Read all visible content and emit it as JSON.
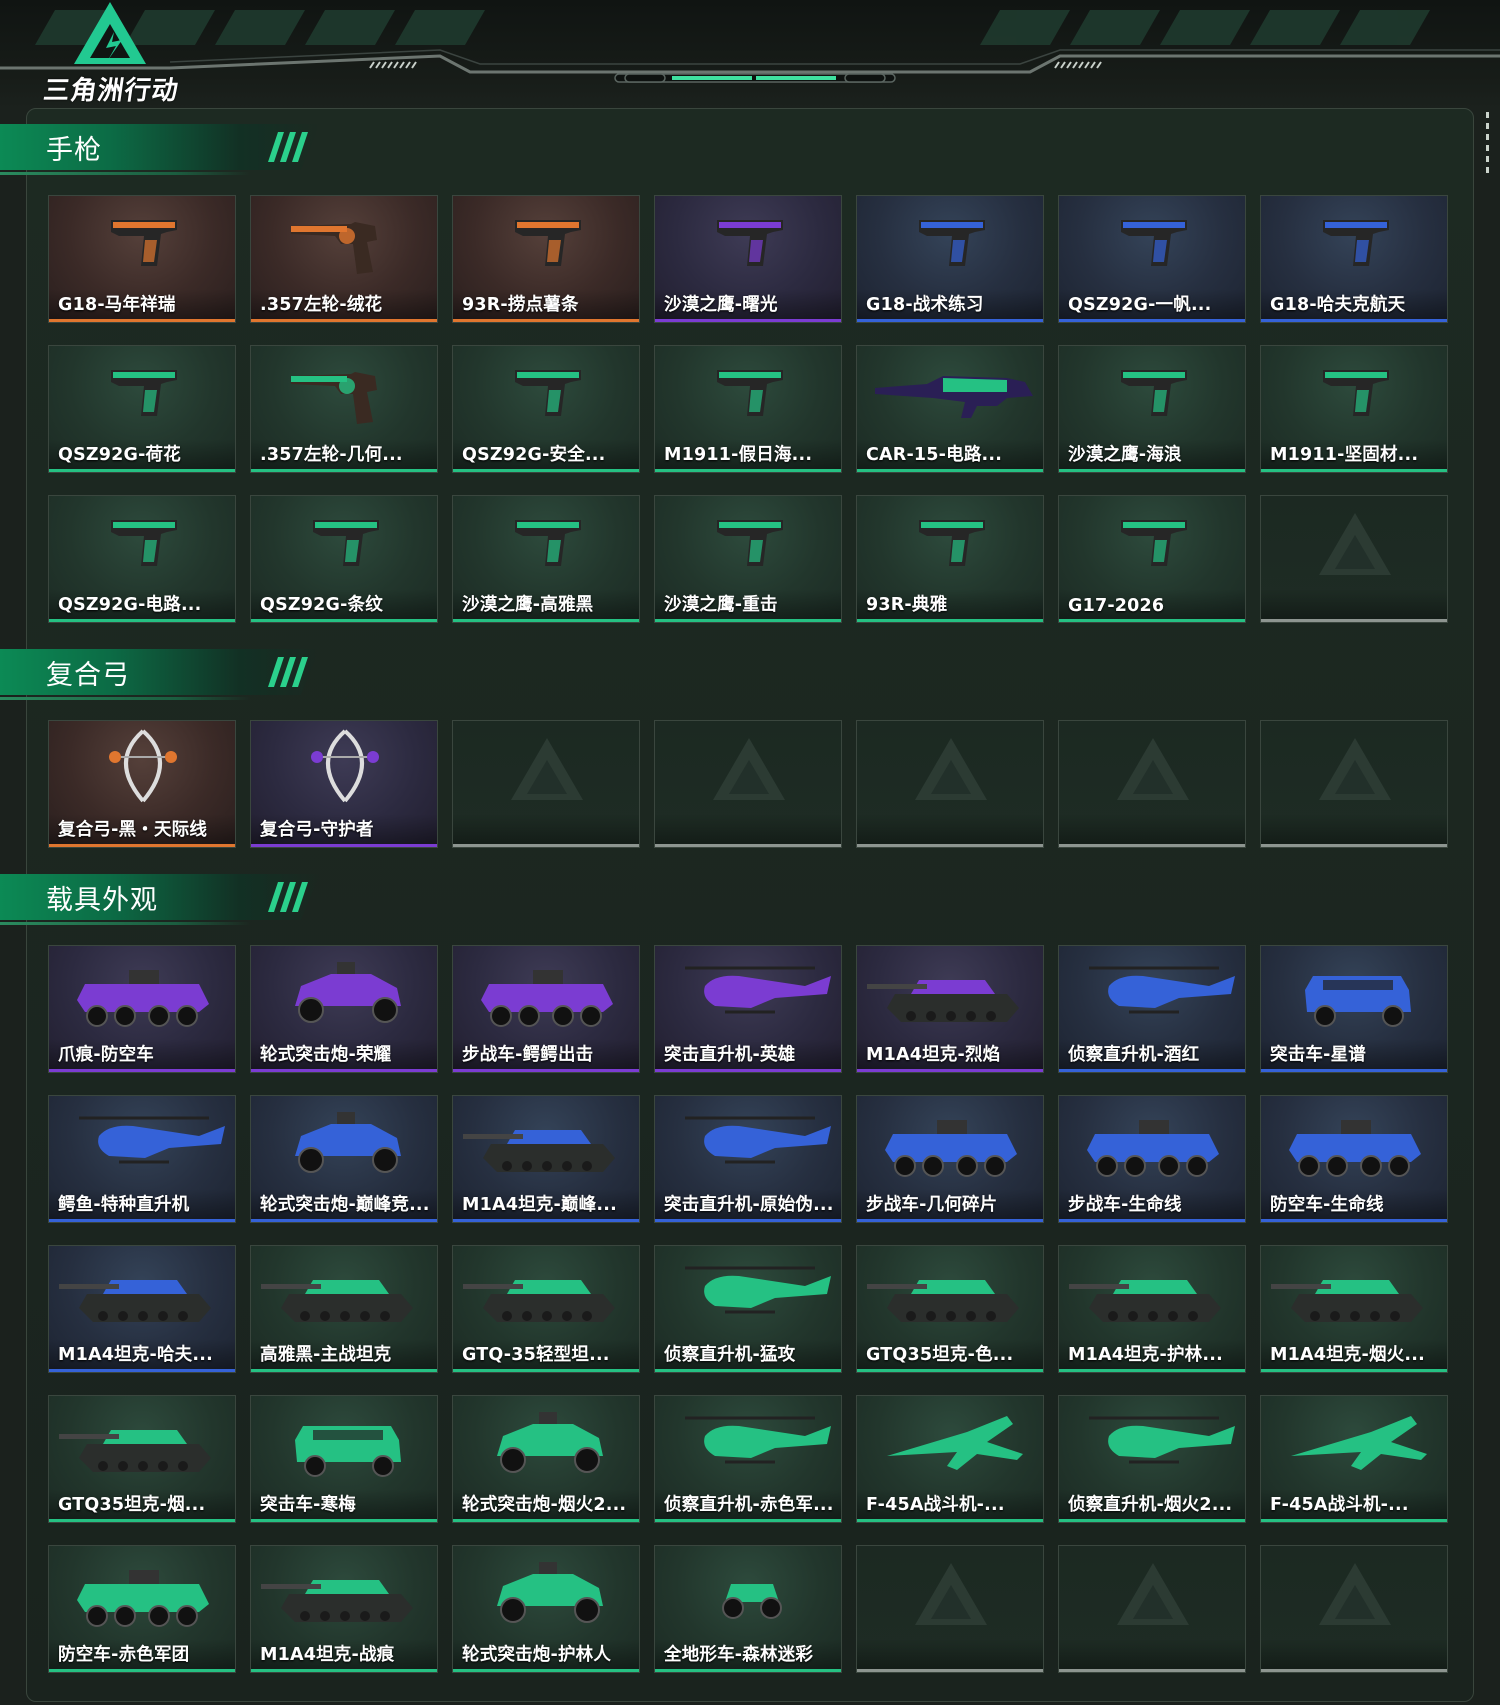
{
  "app": {
    "logo_text": "三角洲行动"
  },
  "colors": {
    "orange": "#e0762f",
    "purple": "#7b3cd2",
    "blue": "#3562d8",
    "green": "#25c183",
    "empty": "#8d9590",
    "brand": "#1cbf7d"
  },
  "sections": [
    {
      "id": "pistols",
      "title": "手枪",
      "items": [
        {
          "label": "G18-马年祥瑞",
          "rarity": "orange",
          "icon": "pistol-icon"
        },
        {
          "label": ".357左轮-绒花",
          "rarity": "orange",
          "icon": "revolver-icon"
        },
        {
          "label": "93R-捞点薯条",
          "rarity": "orange",
          "icon": "pistol-icon"
        },
        {
          "label": "沙漠之鹰-曙光",
          "rarity": "purple",
          "icon": "pistol-icon"
        },
        {
          "label": "G18-战术练习",
          "rarity": "blue",
          "icon": "pistol-icon"
        },
        {
          "label": "QSZ92G-一帆...",
          "rarity": "blue",
          "icon": "pistol-icon"
        },
        {
          "label": "G18-哈夫克航天",
          "rarity": "blue",
          "icon": "pistol-icon"
        },
        {
          "label": "QSZ92G-荷花",
          "rarity": "green",
          "icon": "pistol-icon"
        },
        {
          "label": ".357左轮-几何...",
          "rarity": "green",
          "icon": "revolver-icon"
        },
        {
          "label": "QSZ92G-安全...",
          "rarity": "green",
          "icon": "pistol-icon"
        },
        {
          "label": "M1911-假日海...",
          "rarity": "green",
          "icon": "pistol-icon"
        },
        {
          "label": "CAR-15-电路...",
          "rarity": "green",
          "icon": "rifle-icon"
        },
        {
          "label": "沙漠之鹰-海浪",
          "rarity": "green",
          "icon": "pistol-icon"
        },
        {
          "label": "M1911-坚固材...",
          "rarity": "green",
          "icon": "pistol-icon"
        },
        {
          "label": "QSZ92G-电路...",
          "rarity": "green",
          "icon": "pistol-icon"
        },
        {
          "label": "QSZ92G-条纹",
          "rarity": "green",
          "icon": "pistol-icon"
        },
        {
          "label": "沙漠之鹰-高雅黑",
          "rarity": "green",
          "icon": "pistol-icon"
        },
        {
          "label": "沙漠之鹰-重击",
          "rarity": "green",
          "icon": "pistol-icon"
        },
        {
          "label": "93R-典雅",
          "rarity": "green",
          "icon": "pistol-icon"
        },
        {
          "label": "G17-2026",
          "rarity": "green",
          "icon": "pistol-icon"
        },
        {
          "label": "",
          "rarity": "empty",
          "icon": ""
        }
      ]
    },
    {
      "id": "compound-bows",
      "title": "复合弓",
      "items": [
        {
          "label": "复合弓-黑・天际线",
          "rarity": "orange",
          "icon": "bow-icon"
        },
        {
          "label": "复合弓-守护者",
          "rarity": "purple",
          "icon": "bow-icon"
        },
        {
          "label": "",
          "rarity": "empty",
          "icon": ""
        },
        {
          "label": "",
          "rarity": "empty",
          "icon": ""
        },
        {
          "label": "",
          "rarity": "empty",
          "icon": ""
        },
        {
          "label": "",
          "rarity": "empty",
          "icon": ""
        },
        {
          "label": "",
          "rarity": "empty",
          "icon": ""
        }
      ]
    },
    {
      "id": "vehicle-skins",
      "title": "载具外观",
      "items": [
        {
          "label": "爪痕-防空车",
          "rarity": "purple",
          "icon": "apc-icon"
        },
        {
          "label": "轮式突击炮-荣耀",
          "rarity": "purple",
          "icon": "buggy-icon"
        },
        {
          "label": "步战车-鳄鳄出击",
          "rarity": "purple",
          "icon": "apc-icon"
        },
        {
          "label": "突击直升机-英雄",
          "rarity": "purple",
          "icon": "helicopter-icon"
        },
        {
          "label": "M1A4坦克-烈焰",
          "rarity": "purple",
          "icon": "tank-icon"
        },
        {
          "label": "侦察直升机-酒红",
          "rarity": "blue",
          "icon": "helicopter-icon"
        },
        {
          "label": "突击车-星谱",
          "rarity": "blue",
          "icon": "truck-icon"
        },
        {
          "label": "鳄鱼-特种直升机",
          "rarity": "blue",
          "icon": "helicopter-icon"
        },
        {
          "label": "轮式突击炮-巅峰竞...",
          "rarity": "blue",
          "icon": "buggy-icon"
        },
        {
          "label": "M1A4坦克-巅峰...",
          "rarity": "blue",
          "icon": "tank-icon"
        },
        {
          "label": "突击直升机-原始伪...",
          "rarity": "blue",
          "icon": "helicopter-icon"
        },
        {
          "label": "步战车-几何碎片",
          "rarity": "blue",
          "icon": "apc-icon"
        },
        {
          "label": "步战车-生命线",
          "rarity": "blue",
          "icon": "apc-icon"
        },
        {
          "label": "防空车-生命线",
          "rarity": "blue",
          "icon": "apc-icon"
        },
        {
          "label": "M1A4坦克-哈夫...",
          "rarity": "blue",
          "icon": "tank-icon"
        },
        {
          "label": "高雅黑-主战坦克",
          "rarity": "green",
          "icon": "tank-icon"
        },
        {
          "label": "GTQ-35轻型坦...",
          "rarity": "green",
          "icon": "tank-icon"
        },
        {
          "label": "侦察直升机-猛攻",
          "rarity": "green",
          "icon": "helicopter-icon"
        },
        {
          "label": "GTQ35坦克-色...",
          "rarity": "green",
          "icon": "tank-icon"
        },
        {
          "label": "M1A4坦克-护林...",
          "rarity": "green",
          "icon": "tank-icon"
        },
        {
          "label": "M1A4坦克-烟火...",
          "rarity": "green",
          "icon": "tank-icon"
        },
        {
          "label": "GTQ35坦克-烟...",
          "rarity": "green",
          "icon": "tank-icon"
        },
        {
          "label": "突击车-寒梅",
          "rarity": "green",
          "icon": "truck-icon"
        },
        {
          "label": "轮式突击炮-烟火2...",
          "rarity": "green",
          "icon": "buggy-icon"
        },
        {
          "label": "侦察直升机-赤色军...",
          "rarity": "green",
          "icon": "helicopter-icon"
        },
        {
          "label": "F-45A战斗机-...",
          "rarity": "green",
          "icon": "jet-icon"
        },
        {
          "label": "侦察直升机-烟火2...",
          "rarity": "green",
          "icon": "helicopter-icon"
        },
        {
          "label": "F-45A战斗机-...",
          "rarity": "green",
          "icon": "jet-icon"
        },
        {
          "label": "防空车-赤色军团",
          "rarity": "green",
          "icon": "apc-icon"
        },
        {
          "label": "M1A4坦克-战痕",
          "rarity": "green",
          "icon": "tank-icon"
        },
        {
          "label": "轮式突击炮-护林人",
          "rarity": "green",
          "icon": "buggy-icon"
        },
        {
          "label": "全地形车-森林迷彩",
          "rarity": "green",
          "icon": "atv-icon"
        },
        {
          "label": "",
          "rarity": "empty",
          "icon": ""
        },
        {
          "label": "",
          "rarity": "empty",
          "icon": ""
        },
        {
          "label": "",
          "rarity": "empty",
          "icon": ""
        }
      ]
    }
  ]
}
